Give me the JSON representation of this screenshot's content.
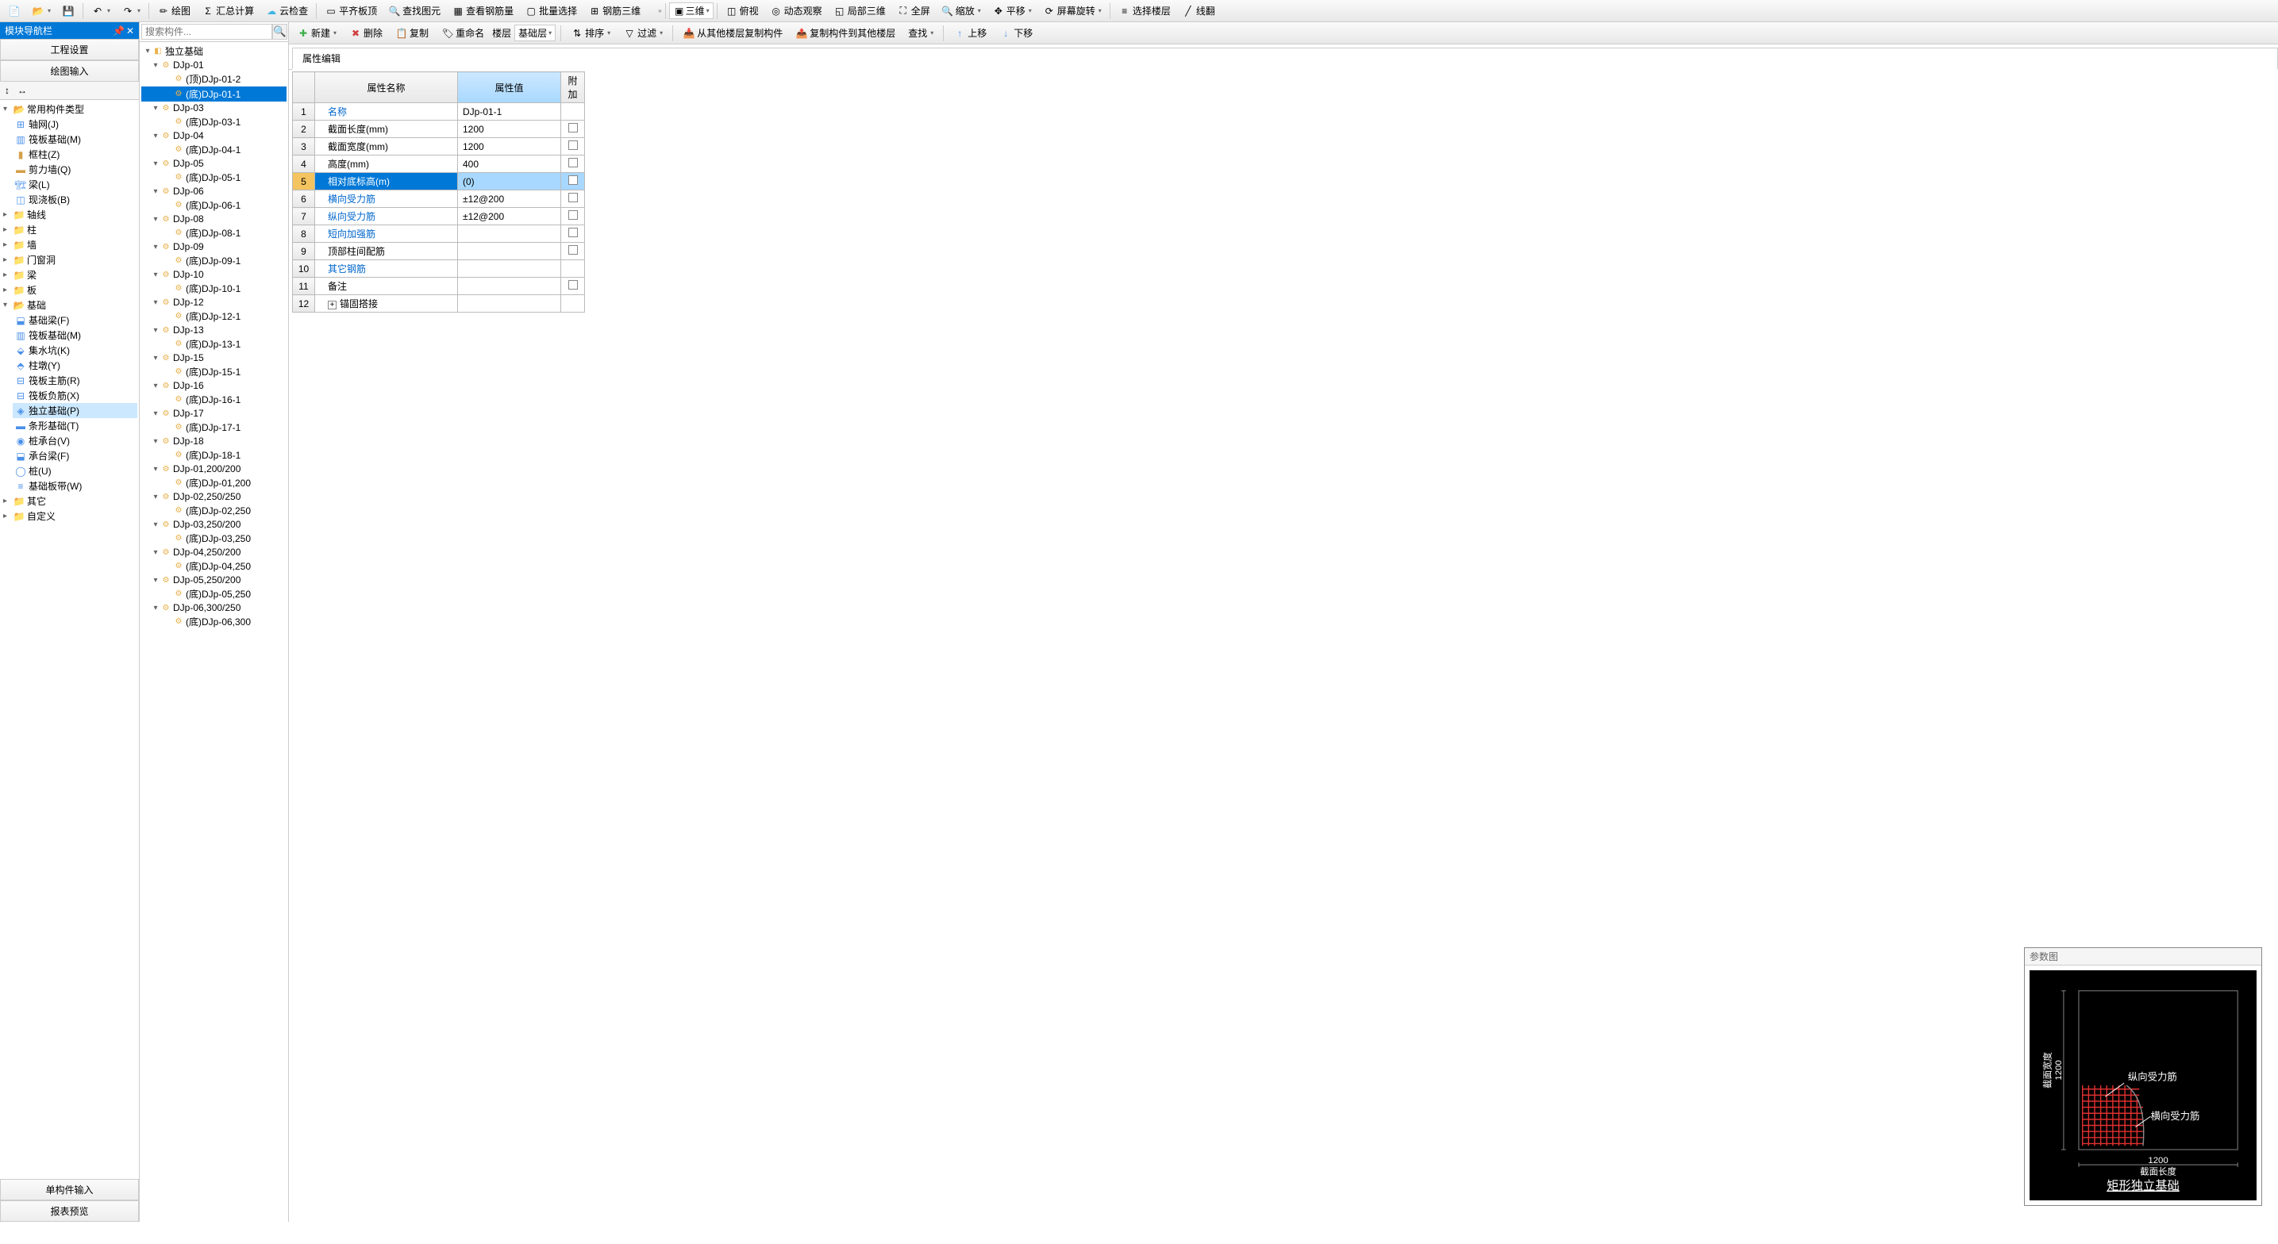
{
  "toolbar1": {
    "draw": "绘图",
    "sumCalc": "汇总计算",
    "cloudCheck": "云检查",
    "flatTop": "平齐板顶",
    "findElement": "查找图元",
    "viewRebar": "查看钢筋量",
    "batchSelect": "批量选择",
    "rebar3d": "钢筋三维",
    "view3d": "三维",
    "overlook": "俯视",
    "dynamicView": "动态观察",
    "local3d": "局部三维",
    "fullscreen": "全屏",
    "zoom": "缩放",
    "pan": "平移",
    "screenRotate": "屏幕旋转",
    "selectFloor": "选择楼层",
    "lineFlip": "线翻"
  },
  "toolbar2": {
    "newItem": "新建",
    "deleteItem": "删除",
    "copyItem": "复制",
    "rename": "重命名",
    "floorLabel": "楼层",
    "floorValue": "基础层",
    "sort": "排序",
    "filter": "过滤",
    "copyFromOther": "从其他楼层复制构件",
    "copyToOther": "复制构件到其他楼层",
    "find": "查找",
    "moveUp": "上移",
    "moveDown": "下移"
  },
  "leftPanel": {
    "title": "模块导航栏",
    "tab1": "工程设置",
    "tab2": "绘图输入",
    "bottomTab1": "单构件输入",
    "bottomTab2": "报表预览"
  },
  "leftTree": {
    "commonType": "常用构件类型",
    "axisGrid": "轴网(J)",
    "raftFound": "筏板基础(M)",
    "frameCol": "框柱(Z)",
    "shearWall": "剪力墙(Q)",
    "beam": "梁(L)",
    "castSlab": "现浇板(B)",
    "axis": "轴线",
    "column": "柱",
    "wall": "墙",
    "door": "门窗洞",
    "beam2": "梁",
    "slab": "板",
    "foundation": "基础",
    "foundBeam": "基础梁(F)",
    "raftFound2": "筏板基础(M)",
    "sump": "集水坑(K)",
    "colCap": "柱墩(Y)",
    "raftMain": "筏板主筋(R)",
    "raftNeg": "筏板负筋(X)",
    "indFound": "独立基础(P)",
    "stripFound": "条形基础(T)",
    "pileCap": "桩承台(V)",
    "capBeam": "承台梁(F)",
    "pile": "桩(U)",
    "foundStrip": "基础板带(W)",
    "other": "其它",
    "custom": "自定义"
  },
  "search": {
    "placeholder": "搜索构件..."
  },
  "middleTree": {
    "root": "独立基础",
    "items": [
      {
        "name": "DJp-01",
        "children": [
          "(顶)DJp-01-2",
          "(底)DJp-01-1"
        ]
      },
      {
        "name": "DJp-03",
        "children": [
          "(底)DJp-03-1"
        ]
      },
      {
        "name": "DJp-04",
        "children": [
          "(底)DJp-04-1"
        ]
      },
      {
        "name": "DJp-05",
        "children": [
          "(底)DJp-05-1"
        ]
      },
      {
        "name": "DJp-06",
        "children": [
          "(底)DJp-06-1"
        ]
      },
      {
        "name": "DJp-08",
        "children": [
          "(底)DJp-08-1"
        ]
      },
      {
        "name": "DJp-09",
        "children": [
          "(底)DJp-09-1"
        ]
      },
      {
        "name": "DJp-10",
        "children": [
          "(底)DJp-10-1"
        ]
      },
      {
        "name": "DJp-12",
        "children": [
          "(底)DJp-12-1"
        ]
      },
      {
        "name": "DJp-13",
        "children": [
          "(底)DJp-13-1"
        ]
      },
      {
        "name": "DJp-15",
        "children": [
          "(底)DJp-15-1"
        ]
      },
      {
        "name": "DJp-16",
        "children": [
          "(底)DJp-16-1"
        ]
      },
      {
        "name": "DJp-17",
        "children": [
          "(底)DJp-17-1"
        ]
      },
      {
        "name": "DJp-18",
        "children": [
          "(底)DJp-18-1"
        ]
      },
      {
        "name": "DJp-01,200/200",
        "children": [
          "(底)DJp-01,200"
        ]
      },
      {
        "name": "DJp-02,250/250",
        "children": [
          "(底)DJp-02,250"
        ]
      },
      {
        "name": "DJp-03,250/200",
        "children": [
          "(底)DJp-03,250"
        ]
      },
      {
        "name": "DJp-04,250/200",
        "children": [
          "(底)DJp-04,250"
        ]
      },
      {
        "name": "DJp-05,250/200",
        "children": [
          "(底)DJp-05,250"
        ]
      },
      {
        "name": "DJp-06,300/250",
        "children": [
          "(底)DJp-06,300"
        ]
      }
    ],
    "selected": "(底)DJp-01-1"
  },
  "propertyTab": {
    "label": "属性编辑",
    "nameHeader": "属性名称",
    "valueHeader": "属性值",
    "attachHeader": "附加",
    "rows": [
      {
        "num": "1",
        "name": "名称",
        "value": "DJp-01-1",
        "attach": null,
        "blue": true
      },
      {
        "num": "2",
        "name": "截面长度(mm)",
        "value": "1200",
        "attach": false,
        "blue": false
      },
      {
        "num": "3",
        "name": "截面宽度(mm)",
        "value": "1200",
        "attach": false,
        "blue": false
      },
      {
        "num": "4",
        "name": "高度(mm)",
        "value": "400",
        "attach": false,
        "blue": false
      },
      {
        "num": "5",
        "name": "相对底标高(m)",
        "value": "(0)",
        "attach": false,
        "blue": false,
        "selected": true
      },
      {
        "num": "6",
        "name": "横向受力筋",
        "value": "±12@200",
        "attach": false,
        "blue": true
      },
      {
        "num": "7",
        "name": "纵向受力筋",
        "value": "±12@200",
        "attach": false,
        "blue": true
      },
      {
        "num": "8",
        "name": "短向加强筋",
        "value": "",
        "attach": false,
        "blue": true
      },
      {
        "num": "9",
        "name": "顶部柱间配筋",
        "value": "",
        "attach": false,
        "blue": false
      },
      {
        "num": "10",
        "name": "其它钢筋",
        "value": "",
        "attach": null,
        "blue": true
      },
      {
        "num": "11",
        "name": "备注",
        "value": "",
        "attach": false,
        "blue": false
      },
      {
        "num": "12",
        "name": "锚固搭接",
        "value": "",
        "attach": null,
        "blue": false,
        "expandable": true
      }
    ]
  },
  "diagram": {
    "title": "参数图",
    "label1": "纵向受力筋",
    "label2": "横向受力筋",
    "xLabel": "截面长度",
    "yLabel": "截面宽度",
    "xValue": "1200",
    "yValue": "1200",
    "caption": "矩形独立基础"
  }
}
